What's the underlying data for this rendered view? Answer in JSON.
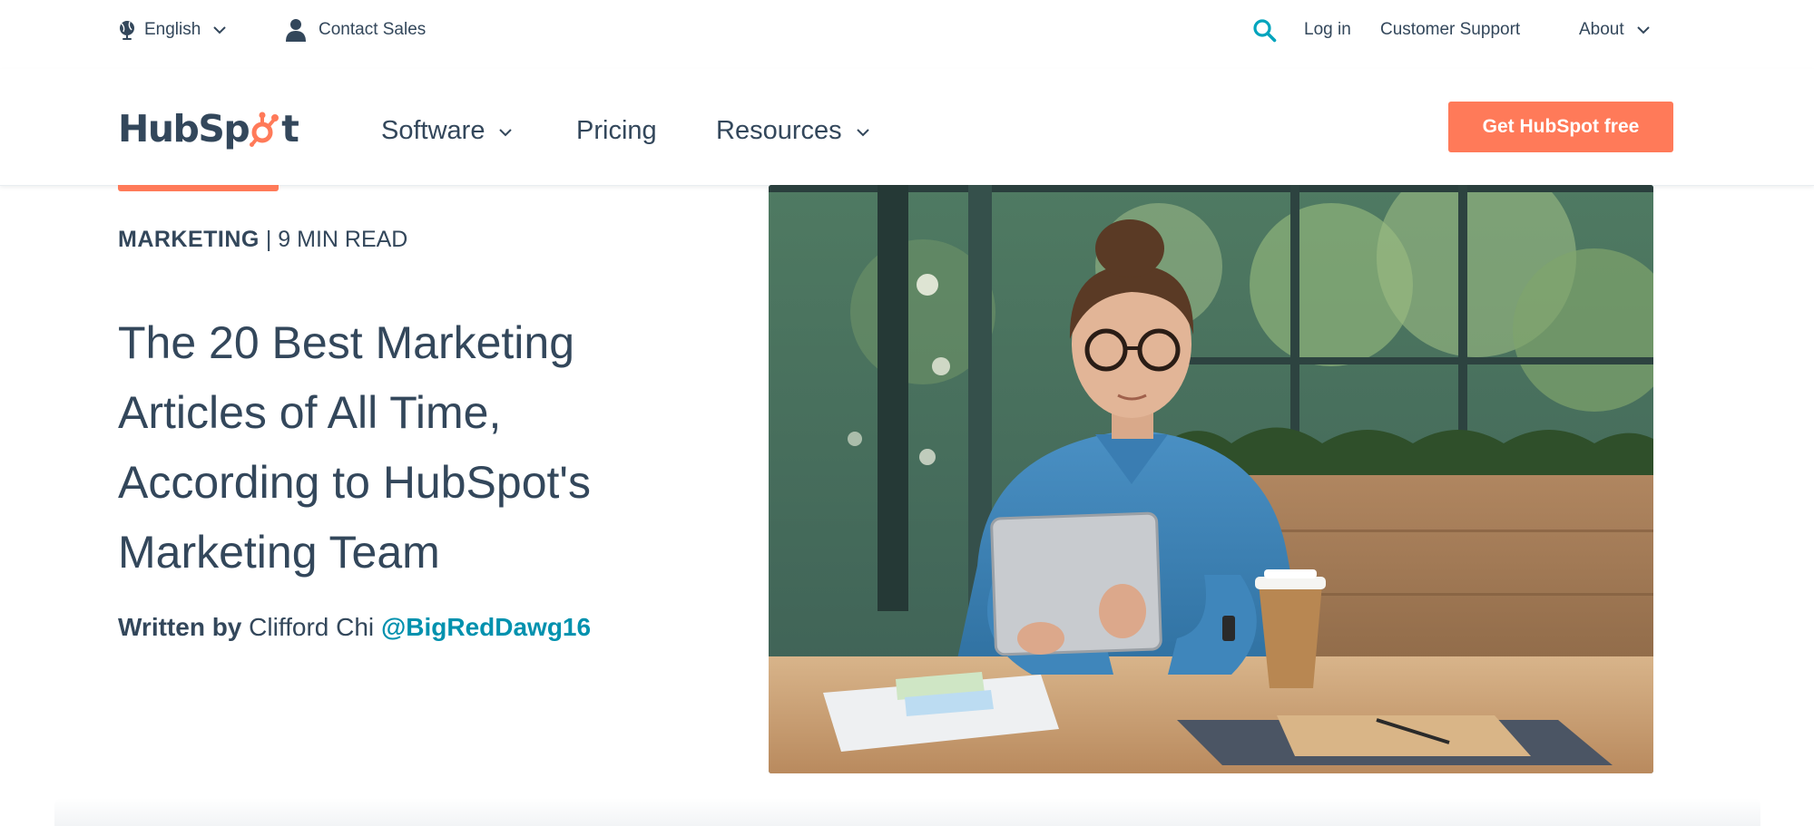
{
  "utility_nav": {
    "language": "English",
    "contact": "Contact Sales",
    "login": "Log in",
    "support": "Customer Support",
    "about": "About"
  },
  "main_nav": {
    "logo": {
      "part1": "HubSp",
      "part2": "t"
    },
    "software": "Software",
    "pricing": "Pricing",
    "resources": "Resources",
    "cta": "Get HubSpot free"
  },
  "article": {
    "topic": "MARKETING",
    "separator": " | ",
    "read_time": "9 MIN READ",
    "title": "The 20 Best Marketing Articles of All Time, According to HubSpot's Marketing Team",
    "byline_label": "Written by",
    "author": "Clifford Chi",
    "handle": "@BigRedDawg16"
  },
  "colors": {
    "brand_orange": "#ff7a59",
    "text_dark": "#33475b",
    "link_teal": "#0091ae",
    "icon_blue": "#00a4bd"
  },
  "icons": [
    "globe-icon",
    "person-icon",
    "search-icon",
    "chevron-down-icon"
  ]
}
